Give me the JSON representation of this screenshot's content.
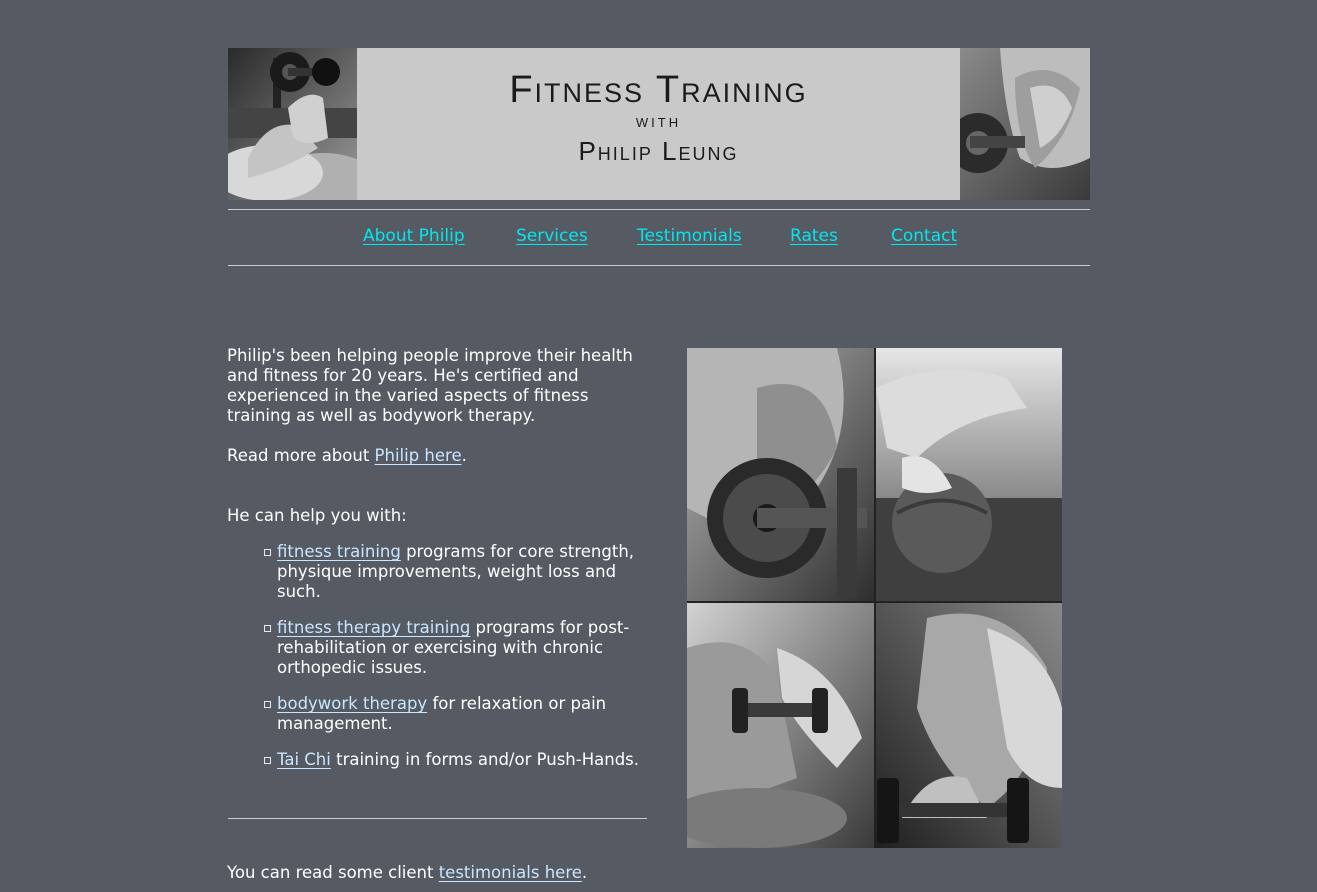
{
  "banner": {
    "title_main": "Fitness Training",
    "title_with": "WITH",
    "title_name": "Philip Leung",
    "left_photo": "dumbbell-curl-photo",
    "right_photo": "dumbbell-row-photo"
  },
  "nav": {
    "items": [
      {
        "label": "About Philip"
      },
      {
        "label": "Services"
      },
      {
        "label": "Testimonials"
      },
      {
        "label": "Rates"
      },
      {
        "label": "Contact"
      }
    ]
  },
  "content": {
    "intro": "Philip's been helping people improve their health and fitness for 20 years. He's certified and experienced in the varied aspects of fitness training as well as bodywork therapy.",
    "read_more_prefix": "Read more about ",
    "read_more_link": "Philip here",
    "read_more_suffix": ".",
    "help_heading": "He can help you with:",
    "services": [
      {
        "link": "fitness training",
        "text": " programs for core strength, physique improvements, weight loss and such."
      },
      {
        "link": "fitness therapy training",
        "text": " programs for post-rehabilitation or exercising with chronic orthopedic issues."
      },
      {
        "link": "bodywork therapy",
        "text": " for relaxation or pain management."
      },
      {
        "link": "Tai Chi",
        "text": " training in forms and/or Push-Hands."
      }
    ],
    "testimonials_prefix": "You can read some client ",
    "testimonials_link": "testimonials here",
    "testimonials_suffix": "."
  },
  "collage": {
    "panels": [
      "dumbbell-row-photo",
      "medicine-ball-pushup-photo",
      "dumbbell-raise-photo",
      "arm-flex-photo"
    ]
  },
  "colors": {
    "background": "#565a63",
    "nav_link": "#00e8f0",
    "body_link": "#c8e6ff",
    "text": "#ffffff",
    "banner_bg": "#c9c9c9"
  }
}
